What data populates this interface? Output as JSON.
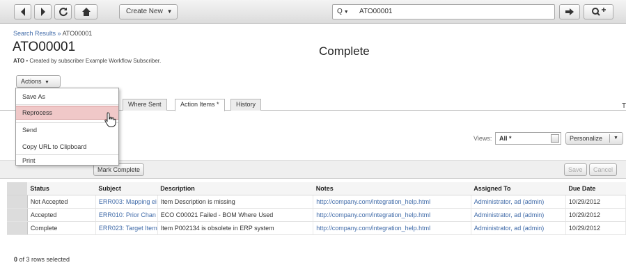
{
  "toolbar": {
    "create_new": "Create New",
    "search_scope": "Q",
    "search_value": "ATO00001"
  },
  "breadcrumb": {
    "link": "Search Results",
    "sep": "»",
    "current": "ATO00001"
  },
  "page": {
    "title": "ATO00001",
    "subtitle_prefix": "ATO",
    "subtitle_text": "• Created by subscriber Example Workflow Subscriber.",
    "status": "Complete"
  },
  "actions": {
    "label": "Actions",
    "menu": [
      "Save As",
      "Reprocess",
      "Send",
      "Copy URL to Clipboard",
      "Print"
    ]
  },
  "tabs": [
    "Where Sent",
    "Action Items *",
    "History"
  ],
  "views": {
    "label": "Views:",
    "value": "All *",
    "personalize": "Personalize"
  },
  "buttons": {
    "mark_complete": "Mark Complete",
    "save": "Save",
    "cancel": "Cancel"
  },
  "table": {
    "headers": [
      "Status",
      "Subject",
      "Description",
      "Notes",
      "Assigned To",
      "Due Date"
    ],
    "rows": [
      [
        "Not Accepted",
        "ERR003: Mapping ei",
        "Item Description is missing",
        "http://company.com/integration_help.html",
        "Administrator, ad (admin)",
        "10/29/2012"
      ],
      [
        "Accepted",
        "ERR010: Prior Chan",
        "ECO C00021 Failed - BOM Where Used",
        "http://company.com/integration_help.html",
        "Administrator, ad (admin)",
        "10/29/2012"
      ],
      [
        "Complete",
        "ERR023: Target Item",
        "Item P002134 is obsolete in ERP system",
        "http://company.com/integration_help.html",
        "Administrator, ad (admin)",
        "10/29/2012"
      ]
    ]
  },
  "footer": {
    "count": "0",
    "text": "of 3 rows selected"
  },
  "colors": {
    "link": "#3f6aa8",
    "menu_highlight": "#f0c8c8"
  }
}
